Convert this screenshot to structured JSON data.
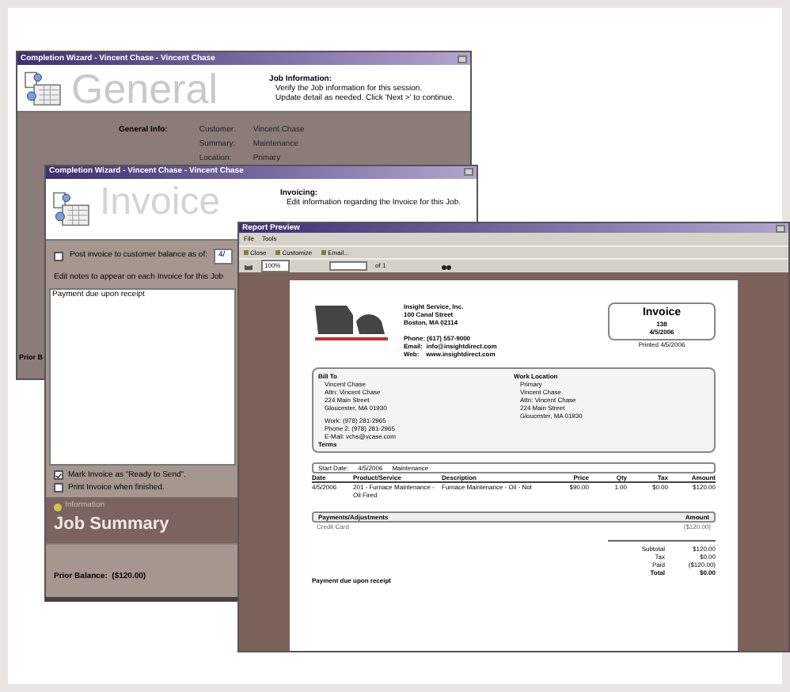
{
  "general_window": {
    "title": "Completion Wizard - Vincent Chase - Vincent Chase",
    "heading": "General",
    "info_title": "Job Information:",
    "info_lines": [
      "Verify the Job information for this session.",
      "Update detail as needed.  Click 'Next >' to continue."
    ],
    "fields_label": "General Info:",
    "fields": [
      {
        "label": "Customer:",
        "value": "Vincent Chase"
      },
      {
        "label": "Summary:",
        "value": "Maintenance"
      },
      {
        "label": "Location:",
        "value": "Primary"
      }
    ],
    "footer": "Prior B"
  },
  "invoice_window": {
    "title": "Completion Wizard - Vincent Chase - Vincent Chase",
    "heading": "Invoice",
    "info_title": "Invoicing:",
    "info_line": "Edit information regarding the Invoice for this Job.",
    "post": {
      "label": "Post invoice to customer balance as of:",
      "checked": false,
      "date": "4/"
    },
    "notes_label": "Edit notes to appear on each Invoice for this Job",
    "notes_value": "Payment due upon receipt",
    "options": [
      {
        "label": "Mark Invoice as \"Ready to Send\".",
        "checked": true
      },
      {
        "label": "Print Invoice when finished.",
        "checked": false
      }
    ],
    "summary_caption": "Information",
    "summary_title": "Job Summary",
    "footer": "Prior Balance:  ($120.00)"
  },
  "report_preview": {
    "title": "Report Preview",
    "menu": [
      "File",
      "Tools"
    ],
    "toolbar": [
      "Close",
      "Customize",
      "Email..."
    ],
    "zoom": "100%",
    "page_of": "of 1",
    "company_lines": [
      "Insight Service, Inc.",
      "100 Canal Street",
      "Boston, MA  02114"
    ],
    "contact_lines": [
      "Phone: (617) 557-9000",
      "Email:  info@insightdirect.com",
      "Web:    www.insightdirect.com"
    ],
    "invoice_box": {
      "title": "Invoice",
      "number": "138",
      "date": "4/5/2006"
    },
    "printed": "Printed 4/5/2006",
    "bill_to": {
      "title": "Bill To",
      "lines": [
        "Vincent Chase",
        "Attn: Vincent Chase",
        "224 Main Street",
        "Gloucester, MA  01930"
      ],
      "contact": [
        "Work: (978) 281-2965",
        "Phone 2: (978) 281-2965",
        "E-Mail: vchs@vcase.com"
      ],
      "terms": "Terms"
    },
    "work_location": {
      "title": "Work Location",
      "lines": [
        "Primary",
        "Vincent Chase",
        "Attn: Vincent Chase",
        "224 Main Street",
        "Gloucester, MA  01930"
      ]
    },
    "job_line": [
      "Start Date:",
      "4/5/2006",
      "Maintenance"
    ],
    "columns": [
      "Date",
      "Product/Service",
      "Description",
      "Price",
      "Qty",
      "Tax",
      "Amount"
    ],
    "rows": [
      [
        "4/5/2006",
        "201 - Furnace Maintenance - Oil Fired",
        "Furnace Maintenance - Oil - Not",
        "$90.00",
        "1.00",
        "$0.00",
        "$120.00"
      ]
    ],
    "payments_header": [
      "Payments/Adjustments",
      "Amount"
    ],
    "payments": [
      [
        "Credit Card",
        "($120.00)"
      ]
    ],
    "totals": [
      {
        "label": "Subtotal",
        "value": "$120.00"
      },
      {
        "label": "Tax",
        "value": "$0.00"
      },
      {
        "label": "Paid",
        "value": "($120.00)"
      },
      {
        "label": "Total",
        "value": "$0.00"
      }
    ],
    "note": "Payment due upon receipt"
  }
}
